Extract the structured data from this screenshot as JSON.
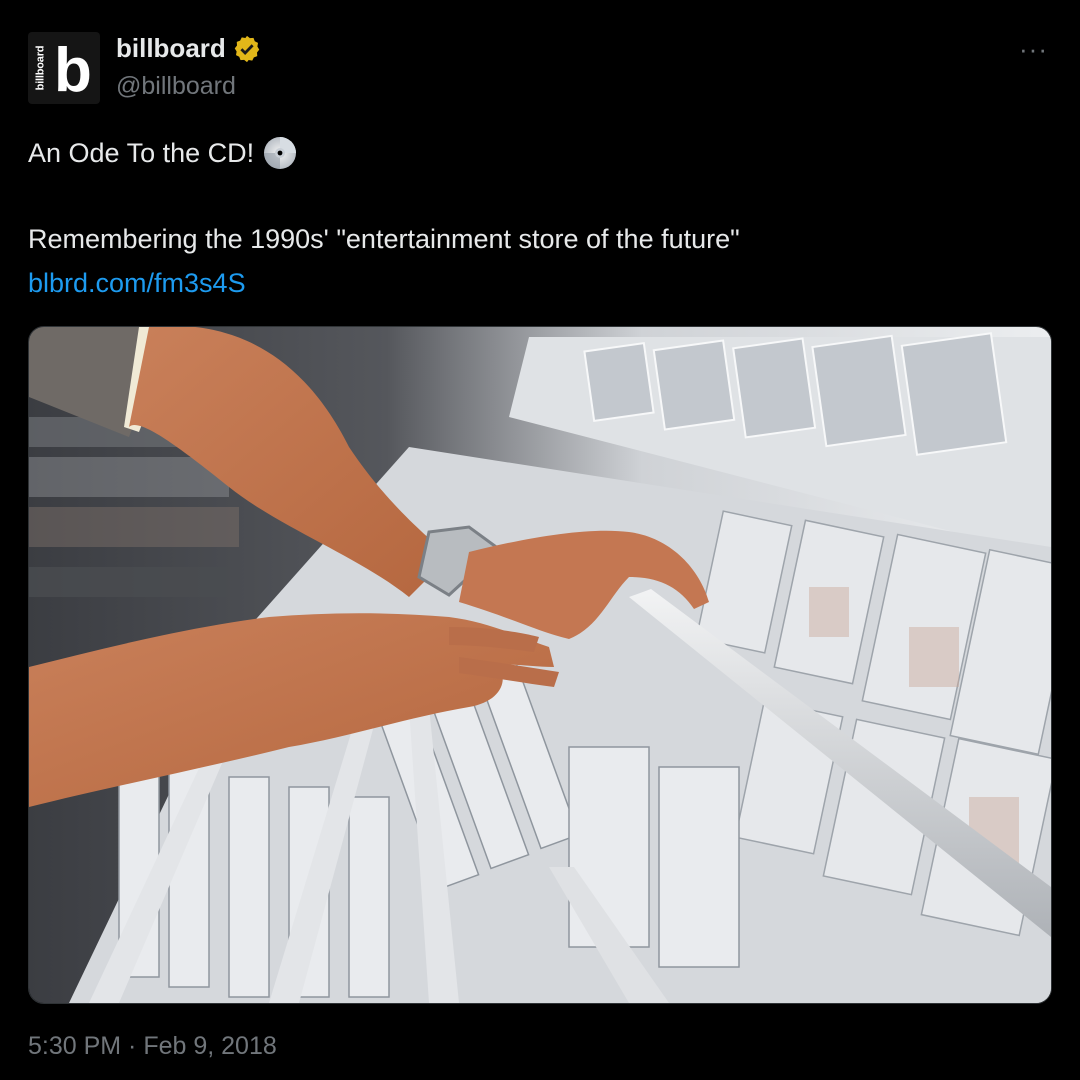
{
  "account": {
    "display_name": "billboard",
    "handle": "@billboard",
    "verified": true,
    "avatar_letter": "b",
    "avatar_wordmark": "billboard",
    "icon": "gold-verified-badge-icon"
  },
  "menu": {
    "more_label": "···",
    "icon": "more-options-icon"
  },
  "tweet": {
    "line1": "An Ode To the CD!",
    "emoji": "optical-disc-icon",
    "line2": "Remembering the 1990s' \"entertainment store of the future\"",
    "link": "blbrd.com/fm3s4S"
  },
  "timestamp": "5:30 PM · Feb 9, 2018",
  "colors": {
    "link": "#1d9bf0",
    "muted": "#71767b",
    "text": "#e7e9ea",
    "verified": "#e2b719"
  }
}
